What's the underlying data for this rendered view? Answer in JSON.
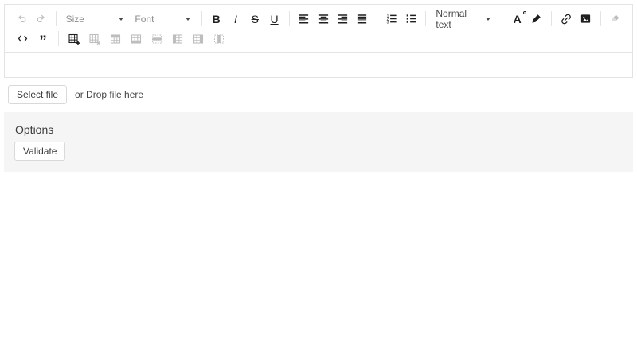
{
  "toolbar": {
    "size_label": "Size",
    "font_label": "Font",
    "heading_label": "Normal text",
    "bold": "B",
    "italic": "I",
    "strikethrough": "S",
    "underline": "U",
    "blockquote": "”",
    "text_color_letter": "A",
    "icons": [
      "undo",
      "redo",
      "align-left",
      "align-center",
      "align-right",
      "align-justify",
      "ordered-list",
      "bullet-list",
      "text-color",
      "highlight-pen",
      "link",
      "image",
      "eraser",
      "code",
      "blockquote",
      "insert-table",
      "delete-table",
      "insert-row-above",
      "insert-row-below",
      "delete-row",
      "insert-column-left",
      "insert-column-right",
      "delete-column"
    ],
    "disabled_icons": [
      "undo",
      "redo",
      "eraser",
      "delete-table",
      "insert-row-above",
      "insert-row-below",
      "delete-row",
      "insert-column-left",
      "insert-column-right",
      "delete-column"
    ]
  },
  "editor": {
    "content": ""
  },
  "uploader": {
    "select_file_button": "Select file",
    "drop_hint": "or Drop file here"
  },
  "options": {
    "title": "Options",
    "validate_button": "Validate"
  },
  "colors": {
    "icon": "#1f1f1f",
    "icon_disabled": "#bdbdbd",
    "border": "#e3e3e3",
    "panel_bg": "#f5f5f5",
    "muted_text": "#8c8c8c"
  }
}
